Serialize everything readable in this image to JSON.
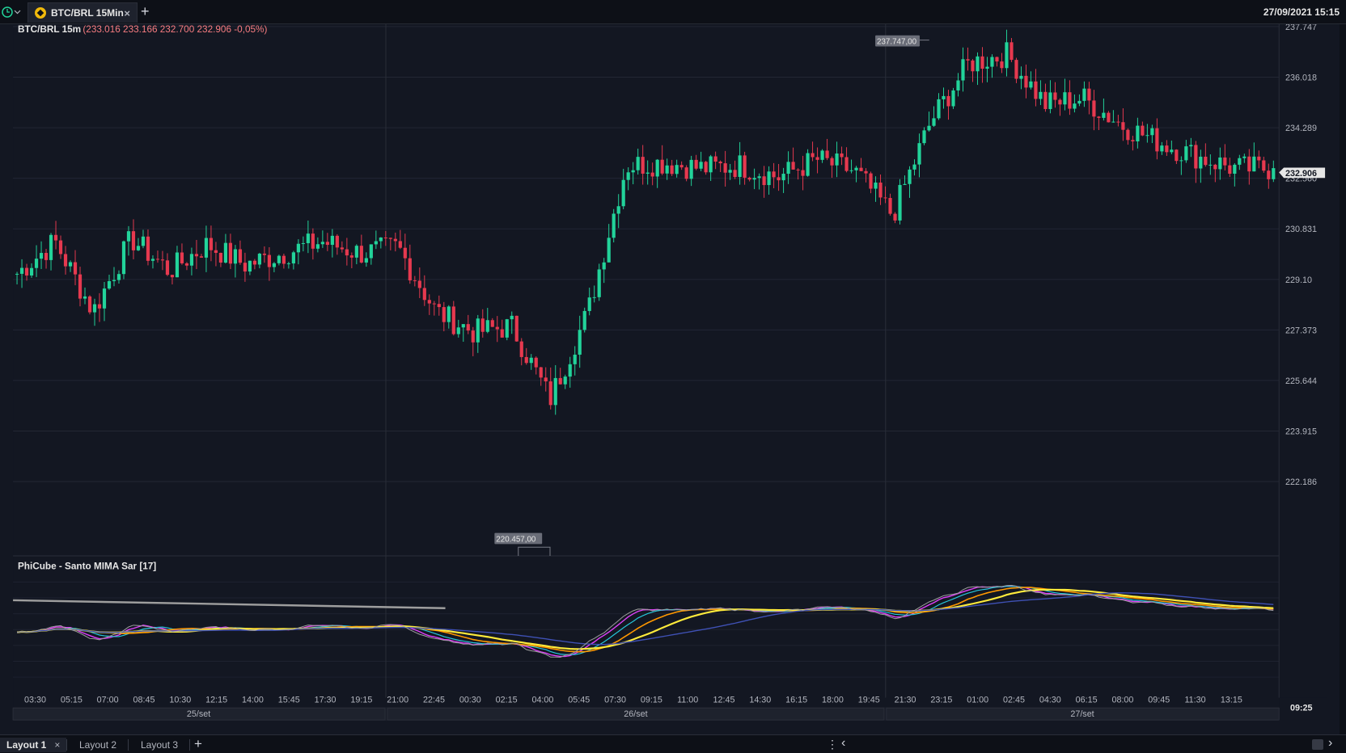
{
  "topbar": {
    "tab_label": "BTC/BRL 15Min",
    "tab_close": "×",
    "add_tab": "+",
    "datetime": "27/09/2021 15:15"
  },
  "chart": {
    "symbol_label": "BTC/BRL 15m",
    "ohlc": "(233.016  233.166  232.700  232.906  -0,05%)",
    "last_price": "232.906",
    "high_marker": "237.747,00",
    "low_marker": "220.457,00",
    "price_ticks": [
      "237.747",
      "236.018",
      "234.289",
      "232.560",
      "230.831",
      "229.10",
      "227.373",
      "225.644",
      "223.915",
      "222.186"
    ],
    "indicator_label": "PhiCube - Santo MIMA Sar [17]",
    "time_labels": [
      "03:30",
      "05:15",
      "07:00",
      "08:45",
      "10:30",
      "12:15",
      "14:00",
      "15:45",
      "17:30",
      "19:15",
      "21:00",
      "22:45",
      "00:30",
      "02:15",
      "04:00",
      "05:45",
      "07:30",
      "09:15",
      "11:00",
      "12:45",
      "14:30",
      "16:15",
      "18:00",
      "19:45",
      "21:30",
      "23:15",
      "01:00",
      "02:45",
      "04:30",
      "06:15",
      "08:00",
      "09:45",
      "11:30",
      "13:15"
    ],
    "date_labels": [
      "25/set",
      "26/set",
      "27/set"
    ],
    "corner_time": "09:25",
    "colors": {
      "up": "#22d39a",
      "down": "#e6394f",
      "background": "#131722"
    }
  },
  "chart_data": {
    "type": "candlestick",
    "title": "BTC/BRL 15m",
    "ylim": [
      220.457,
      237.747
    ],
    "x": [
      "03:30",
      "05:15",
      "07:00",
      "08:45",
      "10:30",
      "12:15",
      "14:00",
      "15:45",
      "17:30",
      "19:15",
      "21:00",
      "22:45",
      "00:30",
      "02:15",
      "04:00",
      "05:45",
      "07:30",
      "09:15",
      "11:00",
      "12:45",
      "14:30",
      "16:15",
      "18:00",
      "19:45",
      "21:30",
      "23:15",
      "01:00",
      "02:45",
      "04:30",
      "06:15",
      "08:00",
      "09:45",
      "11:30",
      "13:15"
    ],
    "close_path": [
      229.3,
      230.4,
      228.0,
      230.5,
      229.4,
      230.3,
      229.6,
      230.0,
      230.4,
      230.0,
      230.2,
      228.0,
      227.3,
      227.5,
      225.0,
      228.0,
      233.0,
      233.1,
      232.9,
      233.0,
      232.6,
      233.2,
      232.8,
      231.3,
      234.5,
      236.5,
      236.8,
      235.1,
      235.3,
      234.4,
      233.8,
      233.3,
      232.9,
      232.9
    ],
    "last": 232.906,
    "high_marker": 237.747,
    "low_marker": 220.457
  },
  "bottombar": {
    "layouts": [
      "Layout 1",
      "Layout 2",
      "Layout 3"
    ],
    "close": "×",
    "add": "+",
    "menu": "⋮",
    "left_arrow": "‹",
    "right_arrow": "›"
  }
}
